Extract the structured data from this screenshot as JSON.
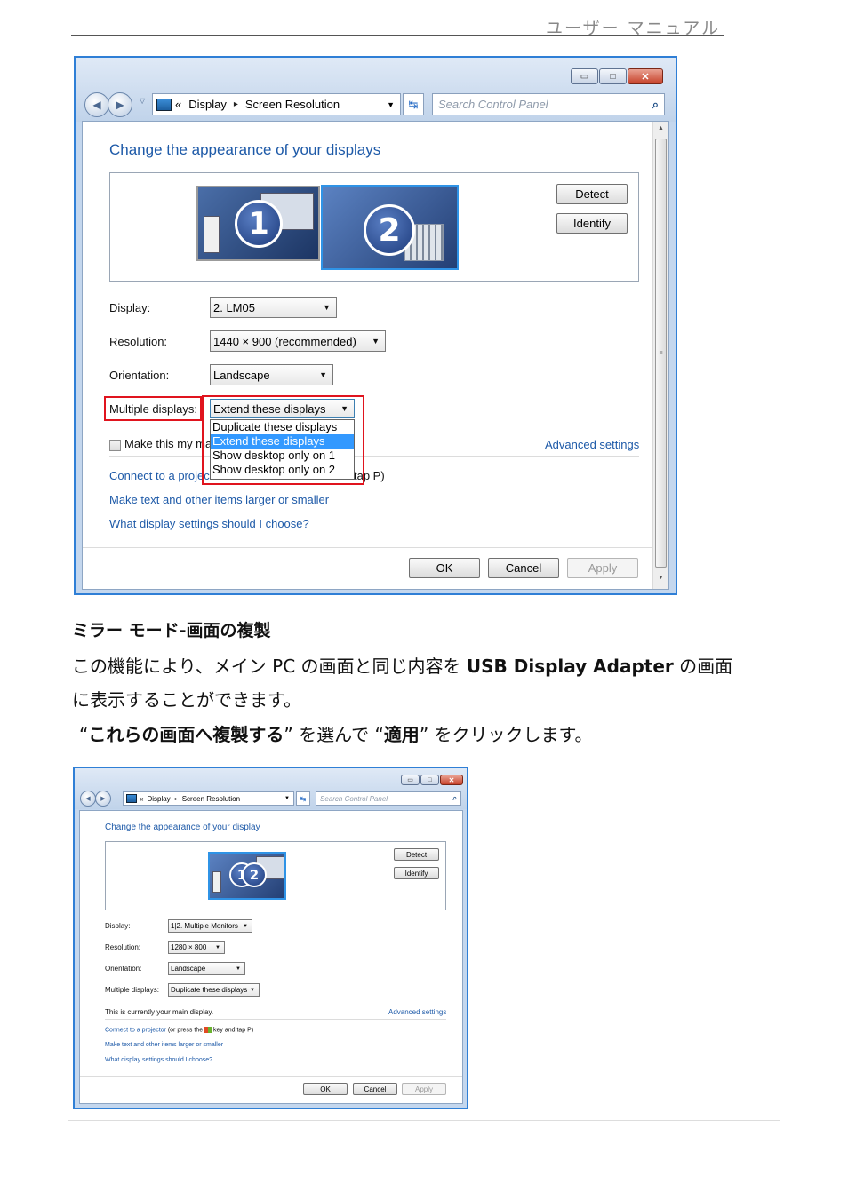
{
  "page_header": "ユーザー マニュアル",
  "screenshot_1": {
    "caption_buttons": {
      "minimize": "▭",
      "maximize": "□",
      "close": "✕"
    },
    "breadcrumb": {
      "prefix": "«",
      "item1": "Display",
      "sep": "▸",
      "item2": "Screen Resolution"
    },
    "search_placeholder": "Search Control Panel",
    "heading": "Change the appearance of your displays",
    "detect_label": "Detect",
    "identify_label": "Identify",
    "monitor1_number": "1",
    "monitor2_number": "2",
    "display_label": "Display:",
    "display_value": "2. LM05",
    "resolution_label": "Resolution:",
    "resolution_value": "1440 × 900 (recommended)",
    "orientation_label": "Orientation:",
    "orientation_value": "Landscape",
    "multiple_label": "Multiple displays:",
    "multiple_value": "Extend these displays",
    "dropdown_options": [
      "Duplicate these displays",
      "Extend these displays",
      "Show desktop only on 1",
      "Show desktop only on 2"
    ],
    "dropdown_selected_index": 1,
    "make_main_partial": "Make this my m",
    "make_main_cut": "a",
    "advanced_settings": "Advanced settings",
    "connect_partial": "Connect to a proje",
    "connect_partial_tail": "c",
    "connect_trailing": "tap P)",
    "link_larger": "Make text and other items larger or smaller",
    "link_choose": "What display settings should I choose?",
    "ok_label": "OK",
    "cancel_label": "Cancel",
    "apply_label": "Apply"
  },
  "section": {
    "heading": "ミラー モード-画面の複製",
    "para_line1_a": "この機能により、メイン PC の画面と同じ内容を ",
    "para_line1_b": "USB Display Adapter",
    "para_line1_c": " の画面",
    "para_line2": "に表示することができます。",
    "instr_q1": "“",
    "instr_b1": "これらの画面へ複製する",
    "instr_q2": "” を選んで “",
    "instr_b2": "適用",
    "instr_q3": "” をクリックします。"
  },
  "screenshot_2": {
    "breadcrumb": {
      "prefix": "«",
      "item1": "Display",
      "sep": "▸",
      "item2": "Screen Resolution"
    },
    "search_placeholder": "Search Control Panel",
    "heading": "Change the appearance of your display",
    "detect_label": "Detect",
    "identify_label": "Identify",
    "monitor_number1": "1",
    "monitor_number2": "2",
    "display_label": "Display:",
    "display_value": "1|2. Multiple Monitors",
    "resolution_label": "Resolution:",
    "resolution_value": "1280 × 800",
    "orientation_label": "Orientation:",
    "orientation_value": "Landscape",
    "multiple_label": "Multiple displays:",
    "multiple_value": "Duplicate these displays",
    "main_display_text": "This is currently your main display.",
    "advanced_settings": "Advanced settings",
    "connect_link": "Connect to a projector",
    "connect_suffix_a": " (or press the ",
    "connect_suffix_b": " key and tap P)",
    "link_larger": "Make text and other items larger or smaller",
    "link_choose": "What display settings should I choose?",
    "ok_label": "OK",
    "cancel_label": "Cancel",
    "apply_label": "Apply"
  }
}
